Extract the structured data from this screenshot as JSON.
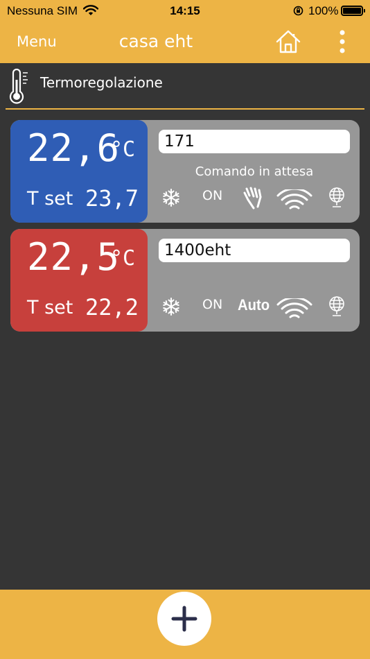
{
  "status_bar": {
    "carrier": "Nessuna SIM",
    "time": "14:15",
    "battery": "100%"
  },
  "nav": {
    "menu_label": "Menu",
    "title": "casa eht",
    "icons": [
      "home-icon",
      "more-vertical-icon"
    ]
  },
  "section": {
    "icon": "thermometer-icon",
    "label": "Termoregolazione"
  },
  "devices": [
    {
      "temperature": "22,6",
      "unit": "°C",
      "tset_label": "T set",
      "tset_value": "23,7",
      "panel_color": "#2F5DB5",
      "name": "171",
      "status": "Comando in attesa",
      "season_icon": "snowflake-icon",
      "state": "ON",
      "mode_icon": "hand-manual-icon",
      "connection_icon": "wifi-icon",
      "cloud_icon": "globe-icon"
    },
    {
      "temperature": "22,5",
      "unit": "°C",
      "tset_label": "T set",
      "tset_value": "22,2",
      "panel_color": "#C7403C",
      "name": "1400eht",
      "status": "",
      "season_icon": "snowflake-icon",
      "state": "ON",
      "mode": "Auto",
      "connection_icon": "wifi-icon",
      "cloud_icon": "globe-icon"
    }
  ],
  "bottom": {
    "add_icon": "plus-icon"
  },
  "colors": {
    "accent": "#EDB445",
    "background": "#353535",
    "card": "#979797"
  }
}
